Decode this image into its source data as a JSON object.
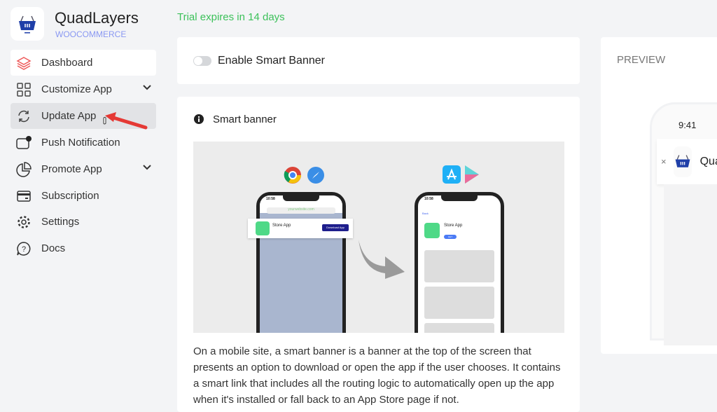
{
  "brand": {
    "name": "QuadLayers",
    "subtitle": "WOOCOMMERCE"
  },
  "sidebar": {
    "items": [
      {
        "label": "Dashboard",
        "icon": "layers-icon"
      },
      {
        "label": "Customize App",
        "icon": "grid-icon",
        "expandable": true
      },
      {
        "label": "Update App",
        "icon": "refresh-icon",
        "hovered": true
      },
      {
        "label": "Push Notification",
        "icon": "notification-icon"
      },
      {
        "label": "Promote App",
        "icon": "pie-chart-icon",
        "expandable": true
      },
      {
        "label": "Subscription",
        "icon": "credit-card-icon"
      },
      {
        "label": "Settings",
        "icon": "gear-icon"
      },
      {
        "label": "Docs",
        "icon": "help-icon"
      }
    ]
  },
  "trial_notice": "Trial expires in 14 days",
  "enable_card": {
    "label": "Enable Smart Banner",
    "enabled": false
  },
  "info_card": {
    "title": "Smart banner",
    "illustration": {
      "url": "yourwebsite.com",
      "app_name": "Store App",
      "download_label": "Download App",
      "back_label": "Back",
      "get_label": "GET",
      "time": "10:58"
    },
    "description": "On a mobile site, a smart banner is a banner at the top of the screen that presents an option to download or open the app if the user chooses. It contains a smart link that includes all the routing logic to automatically open up the app when it's installed or fall back to an App Store page if not."
  },
  "preview": {
    "title": "PREVIEW",
    "time": "9:41",
    "app_name": "QuadLayers"
  },
  "colors": {
    "accent": "#8a98f2",
    "trial": "#3cc15a",
    "annotation_arrow": "#e53935",
    "basket": "#1f3fa8"
  }
}
